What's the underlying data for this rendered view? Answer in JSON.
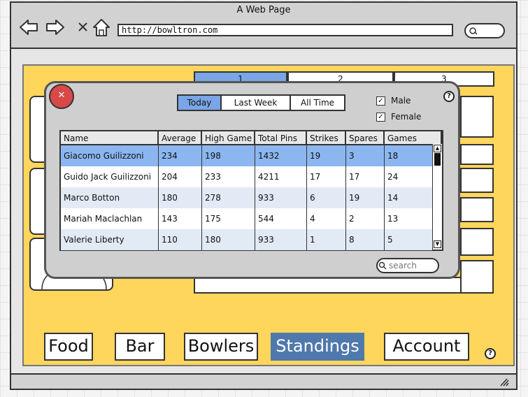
{
  "browser": {
    "title": "A Web Page",
    "url": "http://bowltron.com"
  },
  "app": {
    "top_tabs": [
      "1",
      "2",
      "3"
    ],
    "nav": [
      {
        "label": "Food"
      },
      {
        "label": "Bar"
      },
      {
        "label": "Bowlers"
      },
      {
        "label": "Standings",
        "active": true
      },
      {
        "label": "Account"
      }
    ],
    "help_glyph": "?"
  },
  "modal": {
    "close_glyph": "✕",
    "help_glyph": "?",
    "periods": [
      {
        "label": "Today",
        "active": true
      },
      {
        "label": "Last Week"
      },
      {
        "label": "All Time"
      }
    ],
    "filters": [
      {
        "label": "Male",
        "checked": true
      },
      {
        "label": "Female",
        "checked": true
      }
    ],
    "search_placeholder": "search",
    "table": {
      "columns": [
        "Name",
        "Average",
        "High Game",
        "Total Pins",
        "Strikes",
        "Spares",
        "Games"
      ],
      "rows": [
        [
          "Giacomo Guilizzoni",
          "234",
          "198",
          "1432",
          "19",
          "3",
          "18"
        ],
        [
          "Guido Jack Guilizzoni",
          "204",
          "233",
          "4211",
          "17",
          "17",
          "24"
        ],
        [
          "Marco Botton",
          "180",
          "278",
          "933",
          "6",
          "19",
          "14"
        ],
        [
          "Mariah Maclachlan",
          "143",
          "175",
          "544",
          "4",
          "2",
          "13"
        ],
        [
          "Valerie Liberty",
          "110",
          "180",
          "933",
          "1",
          "8",
          "5"
        ]
      ],
      "selected_row": 0
    }
  },
  "colors": {
    "app_background": "#ffd65c",
    "active_tab": "#7aa6e8",
    "selected_row": "#8cb6f0",
    "active_nav": "#4f78ad",
    "close_button": "#d94848"
  },
  "icons": [
    "back-arrow-icon",
    "forward-arrow-icon",
    "close-x-icon",
    "home-icon",
    "search-icon",
    "help-icon",
    "resize-grip-icon",
    "checkbox-icon",
    "scroll-up-icon",
    "scroll-down-icon"
  ]
}
